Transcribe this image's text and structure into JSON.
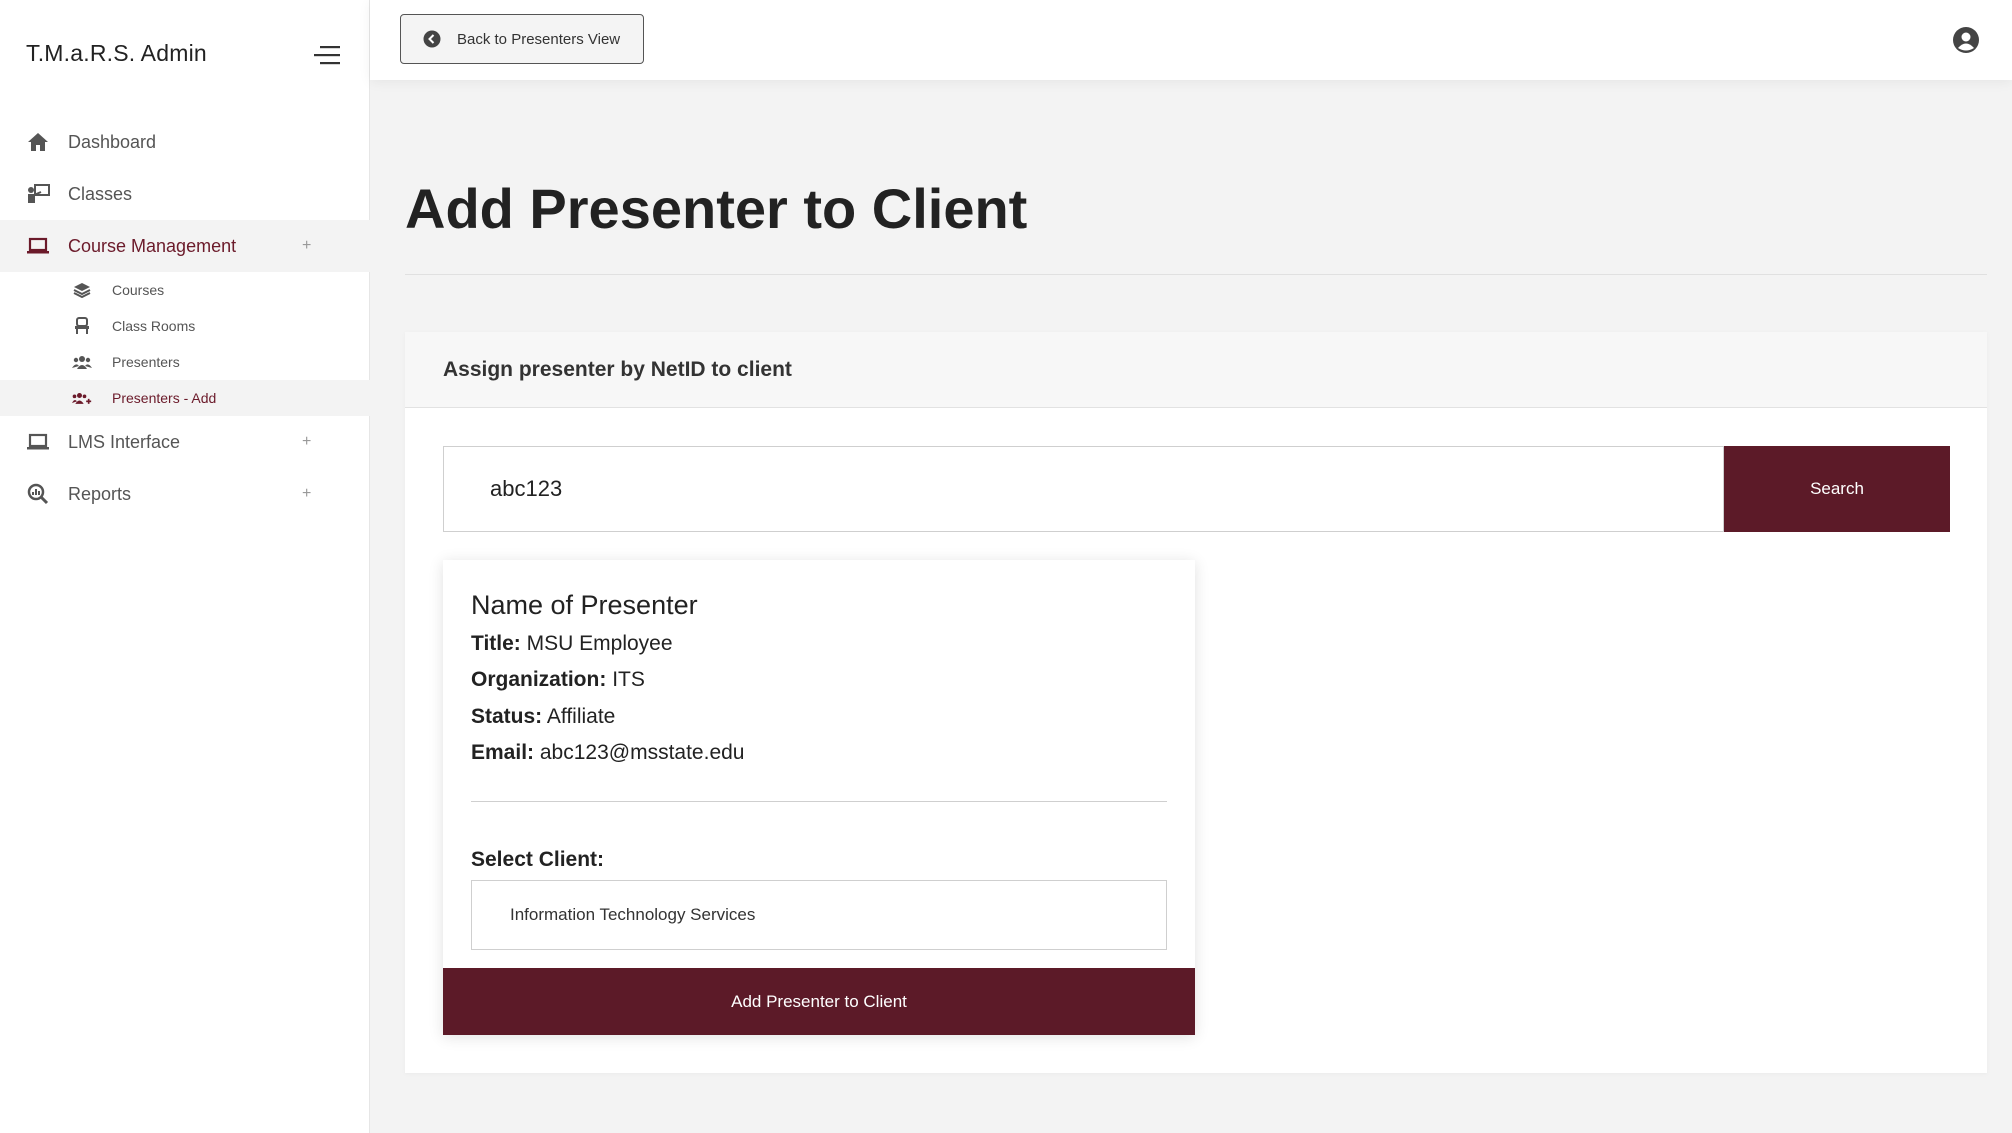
{
  "app": {
    "brand": "T.M.a.R.S. Admin"
  },
  "sidebar": {
    "items": [
      {
        "label": "Dashboard",
        "icon": "home-icon"
      },
      {
        "label": "Classes",
        "icon": "chalkboard-teacher-icon"
      },
      {
        "label": "Course Management",
        "icon": "laptop-icon",
        "expander": "+"
      },
      {
        "label": "LMS Interface",
        "icon": "laptop-icon",
        "expander": "+"
      },
      {
        "label": "Reports",
        "icon": "search-chart-icon",
        "expander": "+"
      }
    ],
    "subitems": [
      {
        "label": "Courses",
        "icon": "layers-icon"
      },
      {
        "label": "Class Rooms",
        "icon": "chair-icon"
      },
      {
        "label": "Presenters",
        "icon": "users-icon"
      },
      {
        "label": "Presenters - Add",
        "icon": "users-plus-icon"
      }
    ]
  },
  "topbar": {
    "back_label": "Back to Presenters View"
  },
  "main": {
    "title": "Add Presenter to Client",
    "card_header": "Assign presenter by NetID to client",
    "search_value": "abc123",
    "search_label": "Search",
    "presenter": {
      "name": "Name of Presenter",
      "title_label": "Title:",
      "title_value": "MSU Employee",
      "org_label": "Organization:",
      "org_value": "ITS",
      "status_label": "Status:",
      "status_value": "Affiliate",
      "email_label": "Email:",
      "email_value": "abc123@msstate.edu"
    },
    "select_label": "Select Client:",
    "selected_client": "Information Technology Services",
    "add_label": "Add Presenter to Client"
  },
  "colors": {
    "accent": "#5c1a28",
    "active_text": "#6b1a2a"
  }
}
